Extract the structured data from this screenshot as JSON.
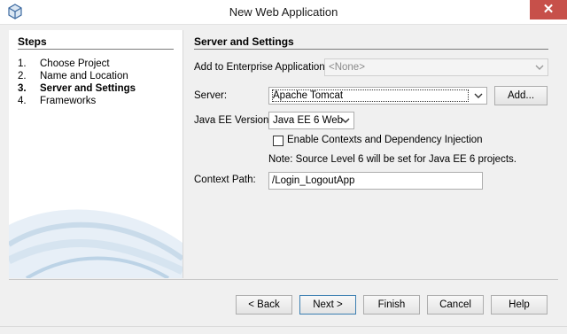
{
  "window": {
    "title": "New Web Application",
    "close_glyph": "✕"
  },
  "steps": {
    "heading": "Steps",
    "items": [
      {
        "num": "1.",
        "label": "Choose Project",
        "current": false
      },
      {
        "num": "2.",
        "label": "Name and Location",
        "current": false
      },
      {
        "num": "3.",
        "label": "Server and Settings",
        "current": true
      },
      {
        "num": "4.",
        "label": "Frameworks",
        "current": false
      }
    ]
  },
  "panel": {
    "heading": "Server and Settings",
    "enterprise_label": "Add to Enterprise Application:",
    "enterprise_value": "<None>",
    "server_label": "Server:",
    "server_value": "Apache Tomcat",
    "add_button": "Add...",
    "javaee_label": "Java EE Version:",
    "javaee_value": "Java EE 6 Web",
    "cdi_checkbox_label": "Enable Contexts and Dependency Injection",
    "cdi_checked": false,
    "note": "Note: Source Level 6 will be set for Java EE 6 projects.",
    "context_label": "Context Path:",
    "context_value": "/Login_LogoutApp"
  },
  "buttons": {
    "back": "< Back",
    "next": "Next >",
    "finish": "Finish",
    "cancel": "Cancel",
    "help": "Help"
  },
  "icons": {
    "app": "netbeans-cube-icon",
    "close": "close-icon",
    "dropdown": "chevron-down-icon"
  },
  "colors": {
    "close_button": "#c7504a",
    "decoration": "#bcd3e6",
    "default_button_border": "#3c7fb1"
  }
}
